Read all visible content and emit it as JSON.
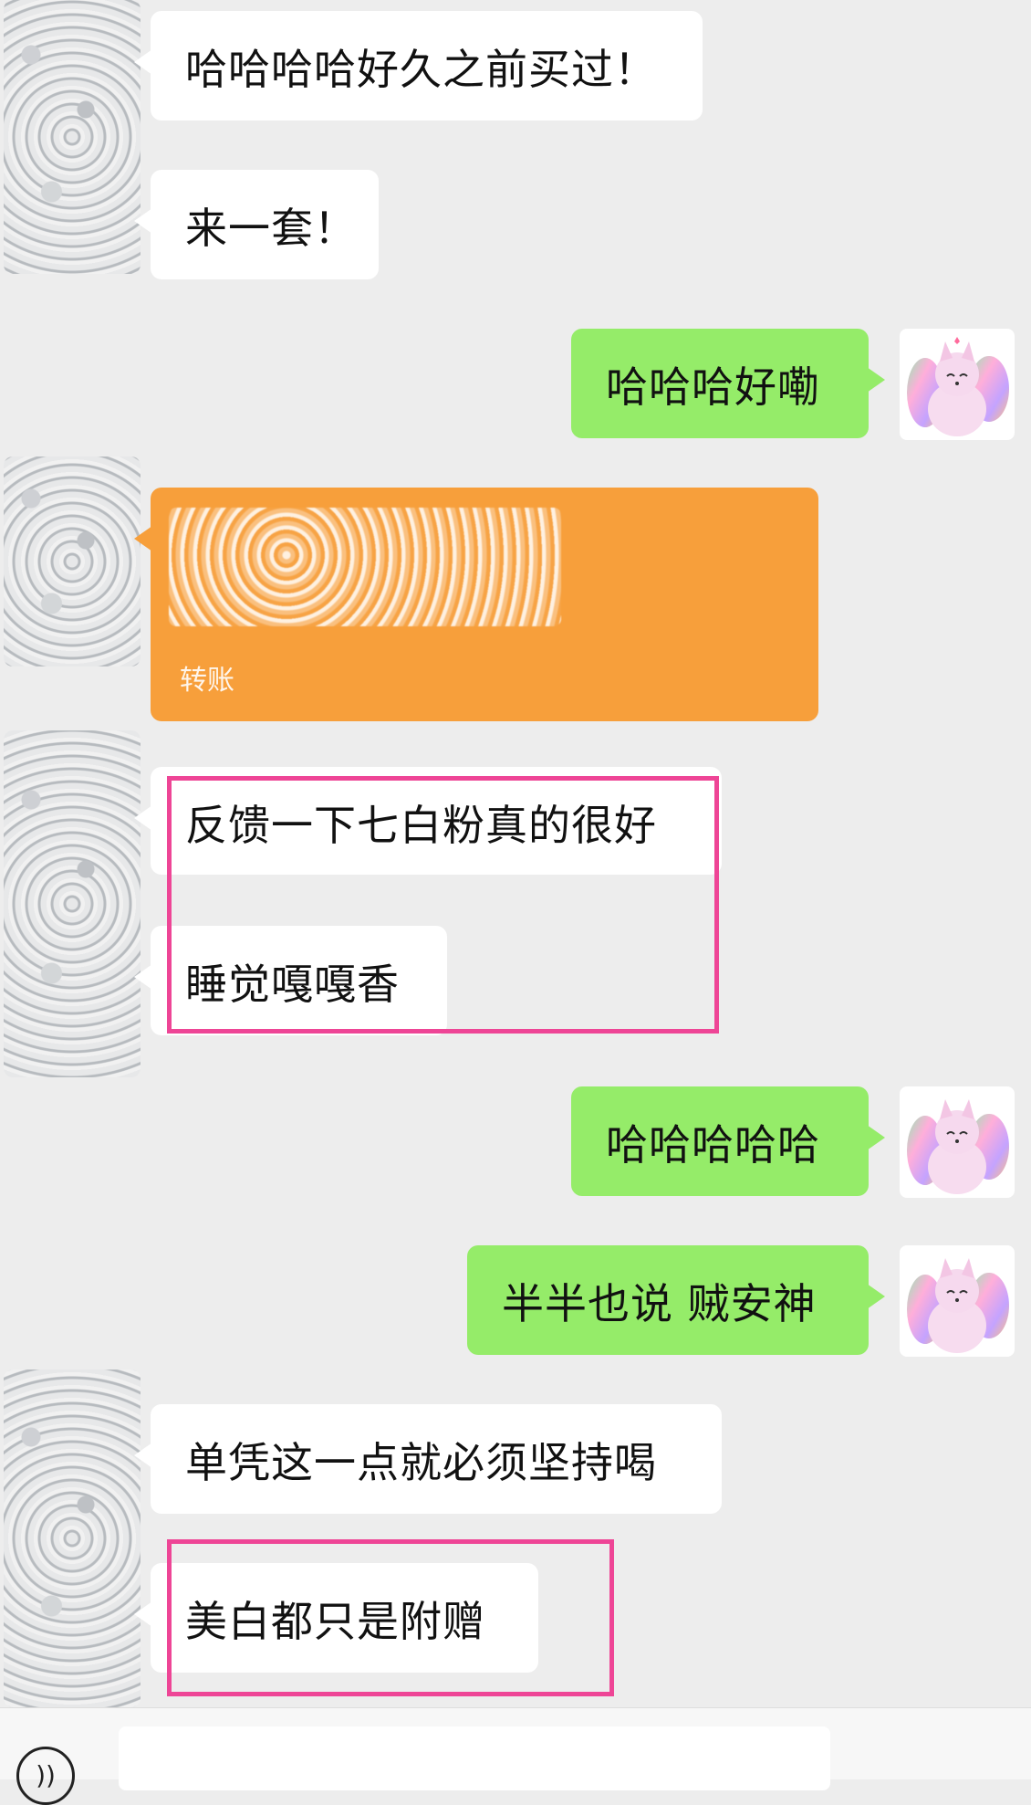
{
  "messages": [
    {
      "text": "哈哈哈哈好久之前买过！"
    },
    {
      "text": "来一套！"
    },
    {
      "text": "哈哈哈好嘞"
    },
    {
      "transfer_label": "转账"
    },
    {
      "text": "反馈一下七白粉真的很好"
    },
    {
      "text": "睡觉嘎嘎香"
    },
    {
      "text": "哈哈哈哈哈"
    },
    {
      "text": "半半也说 贼安神"
    },
    {
      "text": "单凭这一点就必须坚持喝"
    },
    {
      "text": "美白都只是附赠"
    }
  ],
  "colors": {
    "incoming_bubble": "#ffffff",
    "outgoing_bubble": "#95ec69",
    "transfer_bubble": "#f79f3b",
    "highlight_box": "#ee4596",
    "background": "#ededed"
  },
  "icons": {
    "my_avatar": "fox-avatar-icon",
    "contact_avatar": "blurred-avatar-icon",
    "voice_button": "voice-icon"
  }
}
